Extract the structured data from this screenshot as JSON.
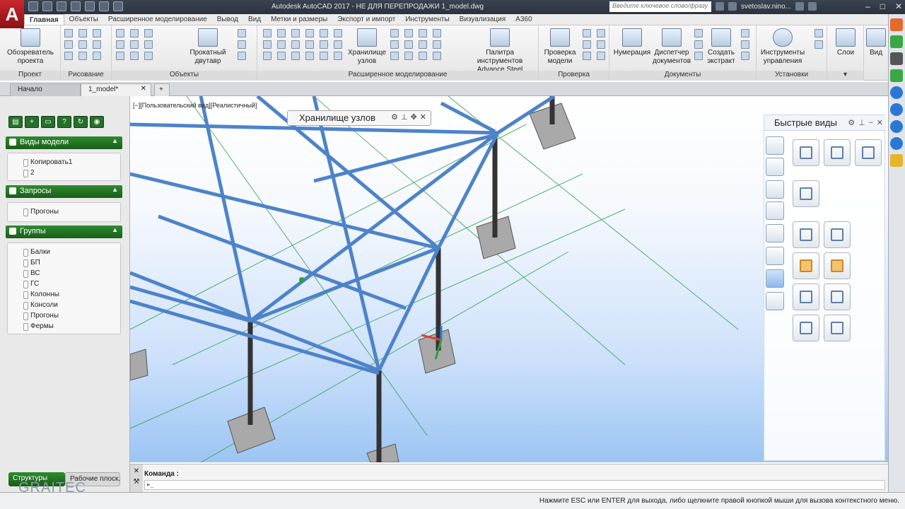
{
  "app": {
    "title": "Autodesk AutoCAD 2017 - НЕ ДЛЯ ПЕРЕПРОДАЖИ   1_model.dwg",
    "logo_letter": "A",
    "search_placeholder": "Введите ключевое слово/фразу",
    "user": "svetoslav.nino...",
    "win_minimize": "–",
    "win_restore": "□",
    "win_close": "✕"
  },
  "ribbon_tabs": [
    "Главная",
    "Объекты",
    "Расширенное моделирование",
    "Вывод",
    "Вид",
    "Метки и размеры",
    "Экспорт и импорт",
    "Инструменты",
    "Визуализация",
    "A360"
  ],
  "ribbon": {
    "panels": {
      "project": "Проект",
      "drawing": "Рисование",
      "objects": "Объекты",
      "advanced_modeling": "Расширенное моделирование",
      "check": "Проверка",
      "documents": "Документы",
      "settings": "Установки"
    },
    "buttons": {
      "project_explorer": "Обозреватель проекта",
      "rolled_ibeam": "Прокатный двутавр",
      "node_storage": "Хранилище узлов",
      "tool_palette": "Палитра инструментов Advance Steel",
      "check_model": "Проверка модели",
      "numbering": "Нумерация",
      "doc_manager": "Диспетчер документов",
      "create_extract": "Создать экстракт",
      "mgmt_tools": "Инструменты управления",
      "layers": "Слои",
      "view": "Вид"
    }
  },
  "doc_tabs": [
    "Начало",
    "1_model*"
  ],
  "viewport": {
    "label": "[−][Пользовательский вид][Реалистичный]",
    "node_storage_title": "Хранилище узлов",
    "quick_views_title": "Быстрые виды",
    "colors": {
      "steel": "#4d83c9",
      "steel_dark": "#1b3f73",
      "grid": "#2f9a4a",
      "column": "#333333",
      "footing": "#a9a9a9"
    }
  },
  "left_palette": {
    "sections": [
      {
        "title": "Виды модели",
        "items": [
          "Копировать1",
          "2"
        ]
      },
      {
        "title": "Запросы",
        "items": [
          "Прогоны"
        ]
      },
      {
        "title": "Группы",
        "items": [
          "Балки",
          "БП",
          "ВС",
          "ГС",
          "Колонны",
          "Консоли",
          "Прогоны",
          "Фермы"
        ]
      }
    ],
    "bottom_tabs": [
      "Структуры",
      "Рабочие плоск."
    ],
    "brand": "GRAITEC"
  },
  "command": {
    "label": "Команда :",
    "prompt": "▸_"
  },
  "status_text": "Нажмите ESC или ENTER для выхода, либо щелкните правой кнопкой мыши для вызова контекстного меню."
}
